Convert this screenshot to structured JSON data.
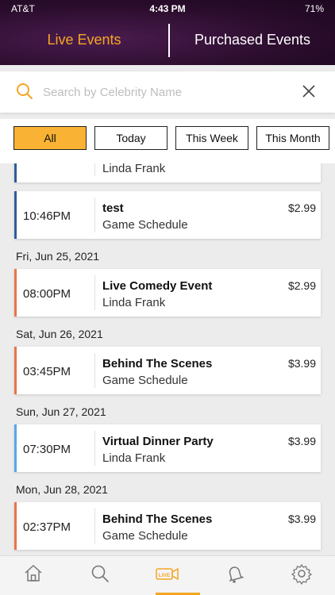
{
  "status_bar": {
    "carrier": "AT&T",
    "time": "4:43 PM",
    "battery": "71%"
  },
  "tabs": {
    "live": "Live Events",
    "purchased": "Purchased Events"
  },
  "search": {
    "placeholder": "Search by Celebrity Name",
    "value": ""
  },
  "filters": [
    "All",
    "Today",
    "This Week",
    "This Month"
  ],
  "list": {
    "partial_card_subtitle": "Linda Frank",
    "cards": [
      {
        "time": "10:46PM",
        "title": "test",
        "subtitle": "Game Schedule",
        "price": "$2.99",
        "accent": "#2f5d9c"
      },
      {
        "time": "08:00PM",
        "title": "Live Comedy Event",
        "subtitle": "Linda Frank",
        "price": "$2.99",
        "accent": "#e8754a"
      },
      {
        "time": "03:45PM",
        "title": "Behind The Scenes",
        "subtitle": "Game Schedule",
        "price": "$3.99",
        "accent": "#e8754a"
      },
      {
        "time": "07:30PM",
        "title": "Virtual Dinner Party",
        "subtitle": "Linda Frank",
        "price": "$3.99",
        "accent": "#5aa6e8"
      },
      {
        "time": "02:37PM",
        "title": "Behind The Scenes",
        "subtitle": "Game Schedule",
        "price": "$3.99",
        "accent": "#e8754a"
      }
    ],
    "dates": [
      "Fri, Jun 25, 2021",
      "Sat, Jun 26, 2021",
      "Sun, Jun 27, 2021",
      "Mon, Jun 28, 2021"
    ]
  },
  "bottom_nav": {
    "items": [
      "home-icon",
      "search-icon",
      "live-icon",
      "bell-icon",
      "gear-icon"
    ],
    "live_label": "LIVE"
  },
  "colors": {
    "accent": "#f5a623",
    "header_bg": "#2a0c2c"
  }
}
